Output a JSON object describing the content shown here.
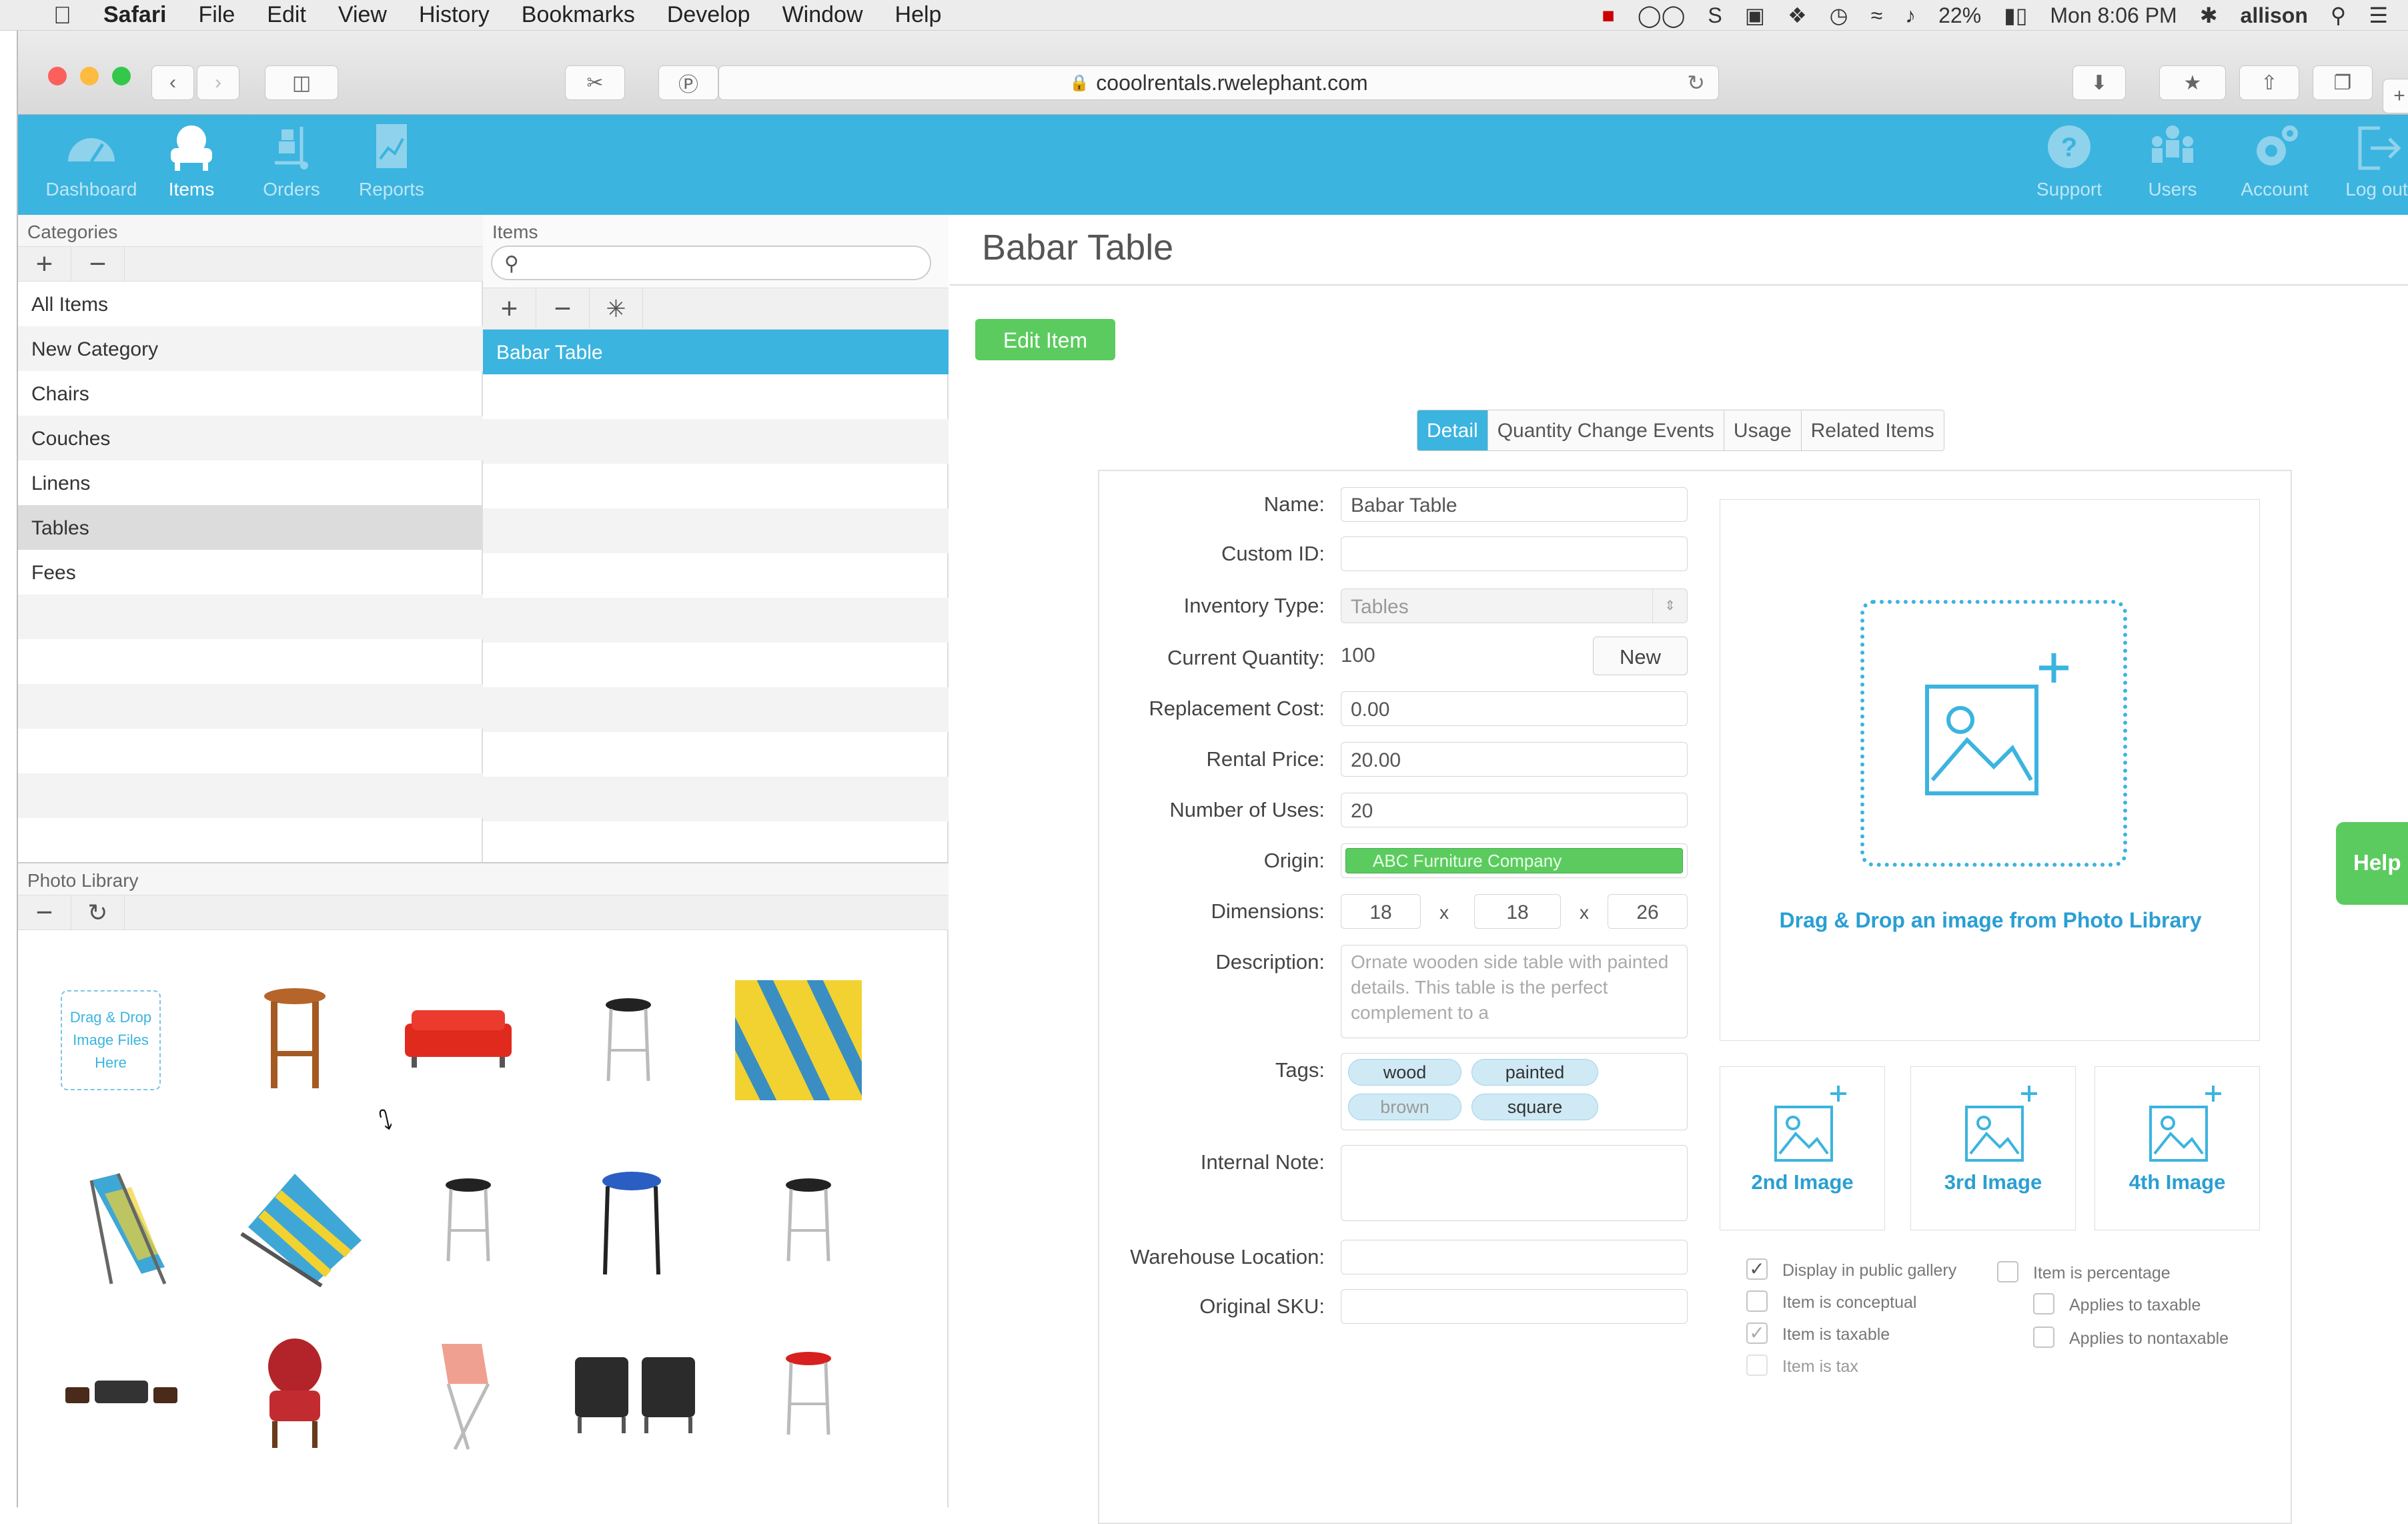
{
  "menubar": {
    "app": "Safari",
    "items": [
      "File",
      "Edit",
      "View",
      "History",
      "Bookmarks",
      "Develop",
      "Window",
      "Help"
    ],
    "battery": "22%",
    "clock": "Mon 8:06 PM",
    "user": "allison"
  },
  "browser": {
    "url": "cooolrentals.rwelephant.com"
  },
  "app_nav": {
    "left": [
      "Dashboard",
      "Items",
      "Orders",
      "Reports"
    ],
    "right": [
      "Support",
      "Users",
      "Account",
      "Log out"
    ],
    "active": "Items"
  },
  "categories": {
    "header": "Categories",
    "items": [
      "All Items",
      "New Category",
      "Chairs",
      "Couches",
      "Linens",
      "Tables",
      "Fees"
    ],
    "selected": "Tables"
  },
  "items_panel": {
    "header": "Items",
    "search_placeholder": "",
    "items": [
      "Babar Table"
    ]
  },
  "photo_library": {
    "header": "Photo Library",
    "dropzone": "Drag & Drop Image Files Here"
  },
  "detail": {
    "title": "Babar Table",
    "edit_button": "Edit Item",
    "tabs": [
      "Detail",
      "Quantity Change Events",
      "Usage",
      "Related Items"
    ],
    "active_tab": "Detail",
    "labels": {
      "name": "Name:",
      "custom_id": "Custom ID:",
      "inventory_type": "Inventory Type:",
      "current_quantity": "Current Quantity:",
      "replacement_cost": "Replacement Cost:",
      "rental_price": "Rental Price:",
      "number_of_uses": "Number of Uses:",
      "origin": "Origin:",
      "dimensions": "Dimensions:",
      "description": "Description:",
      "tags": "Tags:",
      "internal_note": "Internal Note:",
      "warehouse_location": "Warehouse Location:",
      "original_sku": "Original SKU:"
    },
    "values": {
      "name": "Babar Table",
      "custom_id": "",
      "inventory_type": "Tables",
      "current_quantity": "100",
      "new_button": "New",
      "replacement_cost": "0.00",
      "rental_price": "20.00",
      "number_of_uses": "20",
      "origin": "ABC Furniture Company",
      "dim_1": "18",
      "dim_2": "18",
      "dim_3": "26",
      "dim_sep": "x",
      "description": "Ornate wooden side table with painted details. This table is the perfect complement to a",
      "tags": [
        "wood",
        "painted",
        "brown",
        "square"
      ]
    },
    "main_image_text": "Drag & Drop an image from Photo Library",
    "thumbs": [
      "2nd Image",
      "3rd Image",
      "4th Image"
    ],
    "checkboxes_left": [
      {
        "label": "Display in public gallery",
        "checked": true
      },
      {
        "label": "Item is conceptual",
        "checked": false
      },
      {
        "label": "Item is taxable",
        "checked": true
      },
      {
        "label": "Item is tax",
        "checked": false
      }
    ],
    "checkboxes_right": [
      {
        "label": "Item is percentage",
        "checked": false
      },
      {
        "label": "Applies to taxable",
        "checked": false
      },
      {
        "label": "Applies to nontaxable",
        "checked": false
      }
    ]
  },
  "help_button": "Help",
  "colors": {
    "accent": "#3bb4df",
    "green": "#5ccb5f"
  }
}
